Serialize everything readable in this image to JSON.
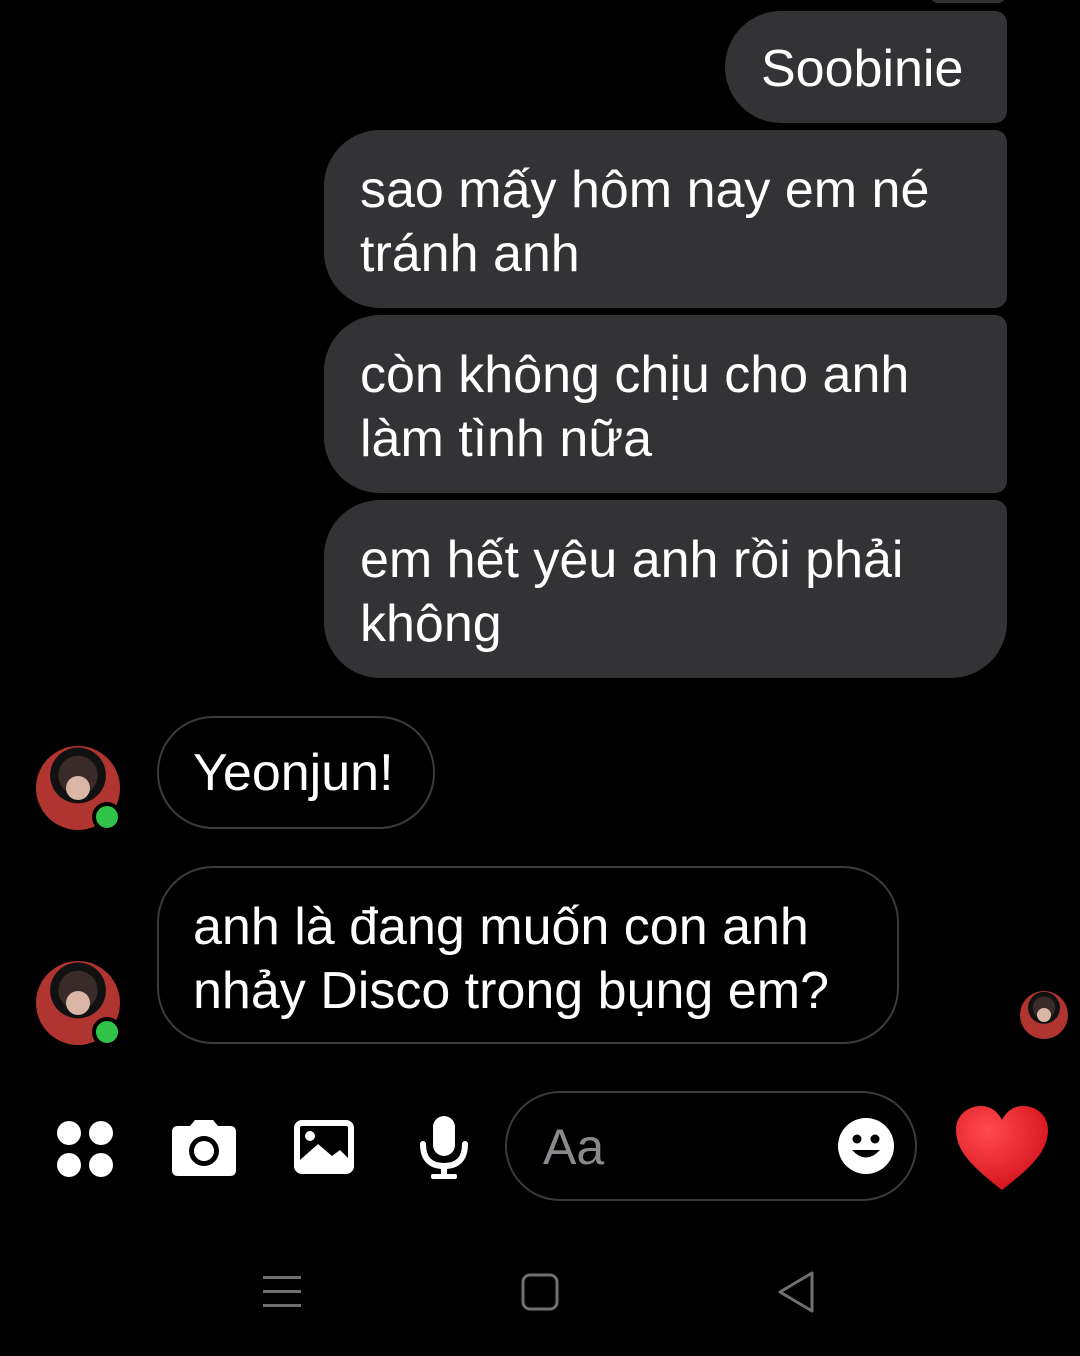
{
  "messages_outgoing": [
    "Soobinie",
    "sao mấy hôm nay em né tránh anh",
    "còn không chịu cho anh làm tình nữa",
    "em hết yêu anh rồi phải không"
  ],
  "messages_incoming": [
    "Yeonjun!",
    "anh là đang muốn con anh nhảy Disco trong bụng em?"
  ],
  "composer": {
    "placeholder": "Aa"
  },
  "icons": {
    "menu": "four-dots-icon",
    "camera": "camera-icon",
    "gallery": "image-icon",
    "mic": "microphone-icon",
    "emoji": "smiley-icon",
    "like": "heart-icon"
  },
  "colors": {
    "background": "#000000",
    "outgoing_bubble": "#333336",
    "incoming_border": "#3b3b3e",
    "online_dot": "#31c24a",
    "heart": "#e8202a"
  }
}
